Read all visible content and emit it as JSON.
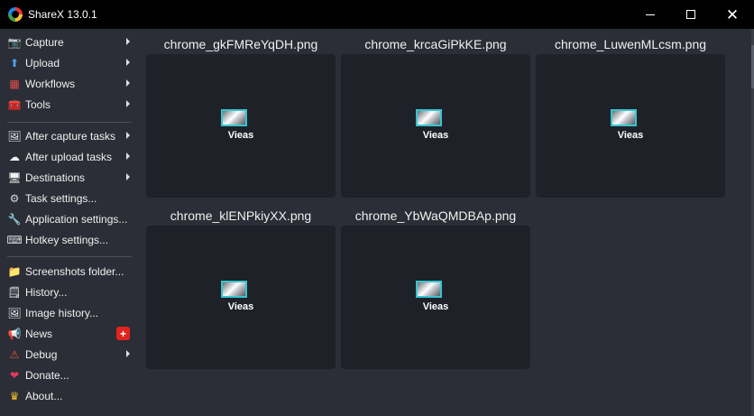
{
  "window": {
    "title": "ShareX 13.0.1"
  },
  "sidebar": {
    "items": [
      {
        "label": "Capture",
        "icon": "camera-icon",
        "glyph": "📷",
        "submenu": true
      },
      {
        "label": "Upload",
        "icon": "upload-arrow-icon",
        "glyph": "⬆",
        "submenu": true
      },
      {
        "label": "Workflows",
        "icon": "workflows-grid-icon",
        "glyph": "▦",
        "submenu": true
      },
      {
        "label": "Tools",
        "icon": "toolbox-icon",
        "glyph": "🧰",
        "submenu": true
      },
      {
        "label": "After capture tasks",
        "icon": "after-capture-icon",
        "glyph": "🖼",
        "submenu": true
      },
      {
        "label": "After upload tasks",
        "icon": "cloud-upload-icon",
        "glyph": "☁",
        "submenu": true
      },
      {
        "label": "Destinations",
        "icon": "destinations-icon",
        "glyph": "🖥",
        "submenu": true
      },
      {
        "label": "Task settings...",
        "icon": "gear-icon",
        "glyph": "⚙",
        "submenu": false
      },
      {
        "label": "Application settings...",
        "icon": "wrench-icon",
        "glyph": "🔧",
        "submenu": false
      },
      {
        "label": "Hotkey settings...",
        "icon": "keyboard-icon",
        "glyph": "⌨",
        "submenu": false
      },
      {
        "label": "Screenshots folder...",
        "icon": "folder-icon",
        "glyph": "📁",
        "submenu": false
      },
      {
        "label": "History...",
        "icon": "history-icon",
        "glyph": "🗒",
        "submenu": false
      },
      {
        "label": "Image history...",
        "icon": "image-history-icon",
        "glyph": "🖼",
        "submenu": false
      },
      {
        "label": "News",
        "icon": "megaphone-icon",
        "glyph": "📢",
        "submenu": false,
        "badge": "+"
      },
      {
        "label": "Debug",
        "icon": "bug-icon",
        "glyph": "⚠",
        "submenu": true
      },
      {
        "label": "Donate...",
        "icon": "heart-icon",
        "glyph": "❤",
        "submenu": false
      },
      {
        "label": "About...",
        "icon": "crown-icon",
        "glyph": "♛",
        "submenu": false
      }
    ]
  },
  "thumbnails": [
    {
      "filename": "chrome_gkFMReYqDH.png",
      "status": "Vieas"
    },
    {
      "filename": "chrome_krcaGiPkKE.png",
      "status": "Vieas"
    },
    {
      "filename": "chrome_LuwenMLcsm.png",
      "status": "Vieas"
    },
    {
      "filename": "chrome_klENPkiyXX.png",
      "status": "Vieas"
    },
    {
      "filename": "chrome_YbWaQMDBAp.png",
      "status": "Vieas"
    }
  ],
  "colors": {
    "background": "#2b2e36",
    "card": "#1f2128",
    "titlebar": "#000000",
    "accent": "#34c6d0",
    "badge": "#e0241f"
  }
}
